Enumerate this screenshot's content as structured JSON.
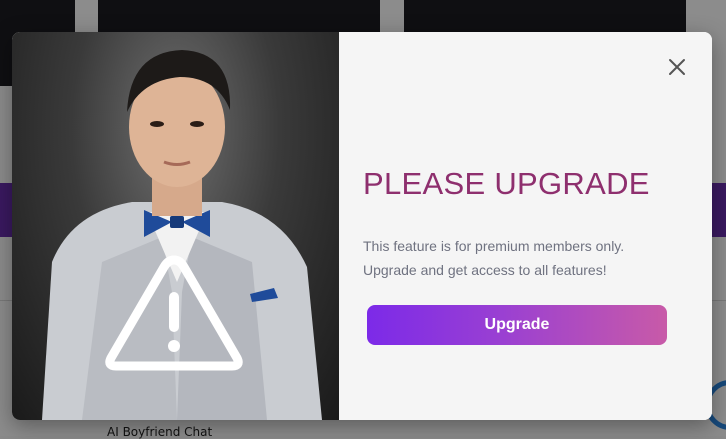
{
  "background": {
    "caption": "AI Boyfriend Chat"
  },
  "modal": {
    "title": "PLEASE UPGRADE",
    "message_line1": "This feature is for premium members only.",
    "message_line2": "Upgrade and get access to all features!",
    "upgrade_label": "Upgrade",
    "close_icon": "close-icon",
    "warning_icon": "warning-triangle-icon",
    "colors": {
      "title": "#8e2f6e",
      "button_start": "#7c2ae8",
      "button_end": "#c85aa8",
      "body_text": "#6f7280"
    }
  }
}
